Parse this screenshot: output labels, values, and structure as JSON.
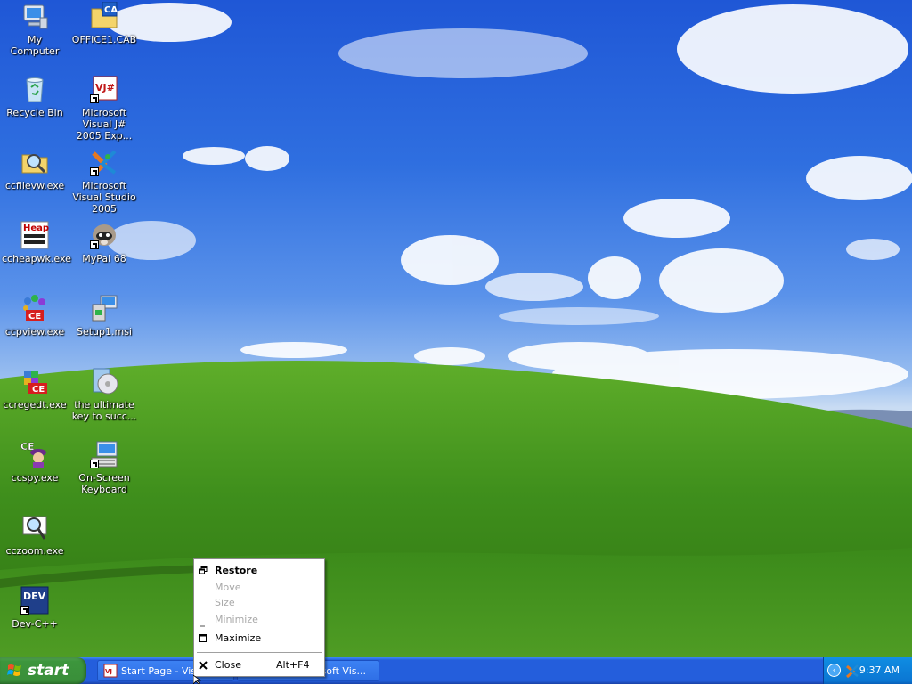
{
  "desktop": {
    "icons": [
      {
        "id": "my-computer",
        "label": "My Computer",
        "icon": "computer-icon"
      },
      {
        "id": "office-cab",
        "label": "OFFICE1.CAB",
        "icon": "cab-file-icon"
      },
      {
        "id": "recycle-bin",
        "label": "Recycle Bin",
        "icon": "recycle-bin-icon"
      },
      {
        "id": "vjsharp",
        "label": "Microsoft Visual J# 2005 Exp...",
        "icon": "vjsharp-icon"
      },
      {
        "id": "ccfilevw",
        "label": "ccfilevw.exe",
        "icon": "file-viewer-icon"
      },
      {
        "id": "vs2005",
        "label": "Microsoft Visual Studio 2005",
        "icon": "visual-studio-icon"
      },
      {
        "id": "ccheapwk",
        "label": "ccheapwk.exe",
        "icon": "heap-walker-icon"
      },
      {
        "id": "mypal",
        "label": "MyPal 68",
        "icon": "raccoon-icon"
      },
      {
        "id": "ccpview",
        "label": "ccpview.exe",
        "icon": "process-viewer-icon"
      },
      {
        "id": "setup1",
        "label": "Setup1.msi",
        "icon": "installer-icon"
      },
      {
        "id": "ccregedt",
        "label": "ccregedt.exe",
        "icon": "registry-editor-icon"
      },
      {
        "id": "ultimate",
        "label": "the ultimate key to succ...",
        "icon": "cd-icon"
      },
      {
        "id": "ccspy",
        "label": "ccspy.exe",
        "icon": "spy-icon"
      },
      {
        "id": "onscreen-kb",
        "label": "On-Screen Keyboard",
        "icon": "keyboard-icon"
      },
      {
        "id": "cczoom",
        "label": "cczoom.exe",
        "icon": "zoom-icon"
      },
      {
        "id": "devcpp",
        "label": "Dev-C++",
        "icon": "dev-cpp-icon"
      }
    ]
  },
  "taskbar": {
    "start_label": "start",
    "tasks": [
      {
        "label": "Start Page - Visu",
        "icon": "vs-task-icon"
      },
      {
        "label": "soft Vis...",
        "icon": "vs-task-icon"
      }
    ],
    "clock": "9:37 AM"
  },
  "context_menu": {
    "items": [
      {
        "label": "Restore",
        "enabled": true,
        "bold": true,
        "icon": "restore-icon"
      },
      {
        "label": "Move",
        "enabled": false
      },
      {
        "label": "Size",
        "enabled": false
      },
      {
        "label": "Minimize",
        "enabled": false,
        "icon": "minimize-icon"
      },
      {
        "label": "Maximize",
        "enabled": true,
        "icon": "maximize-icon"
      },
      {
        "label": "Close",
        "shortcut": "Alt+F4",
        "enabled": true,
        "icon": "close-icon"
      }
    ]
  },
  "colors": {
    "taskbar_blue": "#245edc",
    "start_green": "#3c963c",
    "tray_blue": "#0f8ae0",
    "disabled_text": "#a8a8a8"
  }
}
